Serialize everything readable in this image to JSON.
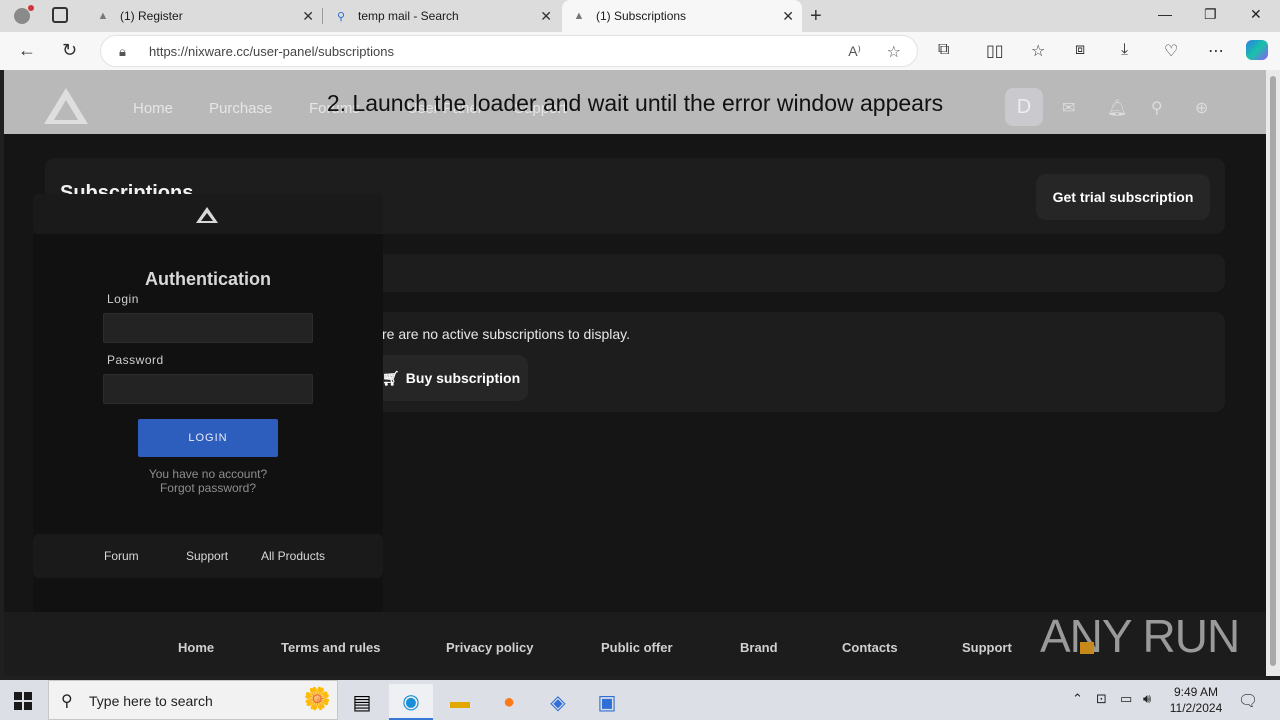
{
  "browser": {
    "tabs": [
      {
        "title": "(1) Register",
        "icon": "nixware-logo-icon"
      },
      {
        "title": "temp mail - Search",
        "icon": "search-icon"
      },
      {
        "title": "(1) Subscriptions",
        "icon": "nixware-logo-icon"
      }
    ],
    "url_host": "https://nixware.cc",
    "url_path": "/user-panel/subscriptions"
  },
  "site": {
    "nav": [
      "Home",
      "Purchase",
      "Forums",
      "User Panel",
      "Support"
    ],
    "avatar_letter": "D",
    "overlay_instruction": "2. Launch the loader and wait until the error window appears",
    "subscriptions_title": "Subscriptions",
    "trial_button": "Get trial subscription",
    "no_subs_text": "re are no active subscriptions to display.",
    "buy_button": "Buy subscription",
    "footer_links": [
      "Home",
      "Terms and rules",
      "Privacy policy",
      "Public offer",
      "Brand",
      "Contacts",
      "Support"
    ]
  },
  "auth": {
    "title": "Authentication",
    "login_label": "Login",
    "password_label": "Password",
    "login_value": "",
    "password_value": "",
    "login_button": "LOGIN",
    "no_account_link": "You have no account?",
    "forgot_link": "Forgot password?",
    "footer_links": [
      "Forum",
      "Support",
      "All Products"
    ]
  },
  "watermark": "ANY RUN",
  "taskbar": {
    "search_placeholder": "Type here to search",
    "time": "9:49 AM",
    "date": "11/2/2024"
  }
}
